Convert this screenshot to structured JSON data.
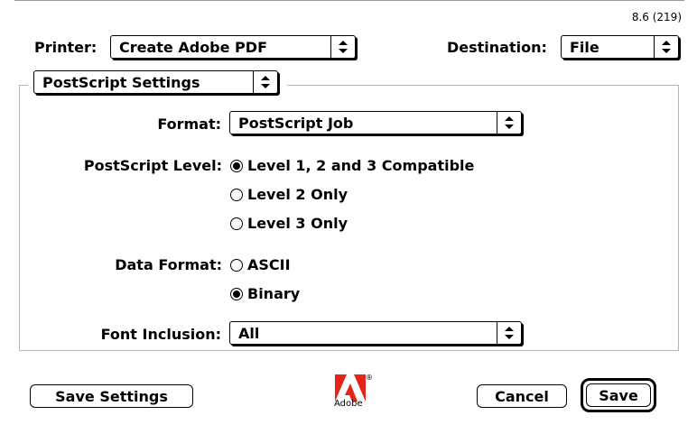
{
  "version": "8.6 (219)",
  "printer": {
    "label": "Printer:",
    "value": "Create Adobe PDF"
  },
  "destination": {
    "label": "Destination:",
    "value": "File"
  },
  "panel": {
    "selector": "PostScript Settings"
  },
  "format": {
    "label": "Format:",
    "value": "PostScript Job"
  },
  "postscript_level": {
    "label": "PostScript Level:",
    "options": [
      {
        "label": "Level 1, 2 and 3 Compatible",
        "selected": true
      },
      {
        "label": "Level 2 Only",
        "selected": false
      },
      {
        "label": "Level 3 Only",
        "selected": false
      }
    ]
  },
  "data_format": {
    "label": "Data Format:",
    "options": [
      {
        "label": "ASCII",
        "selected": false
      },
      {
        "label": "Binary",
        "selected": true
      }
    ]
  },
  "font_inclusion": {
    "label": "Font Inclusion:",
    "value": "All"
  },
  "buttons": {
    "save_settings": "Save Settings",
    "cancel": "Cancel",
    "save": "Save"
  },
  "logo": {
    "text": "Adobe",
    "mark": "®",
    "color": "#e5231b"
  },
  "icons": {
    "popup_arrows": "up-down-arrows-icon",
    "radio_on": "radio-selected-icon",
    "radio_off": "radio-unselected-icon"
  }
}
